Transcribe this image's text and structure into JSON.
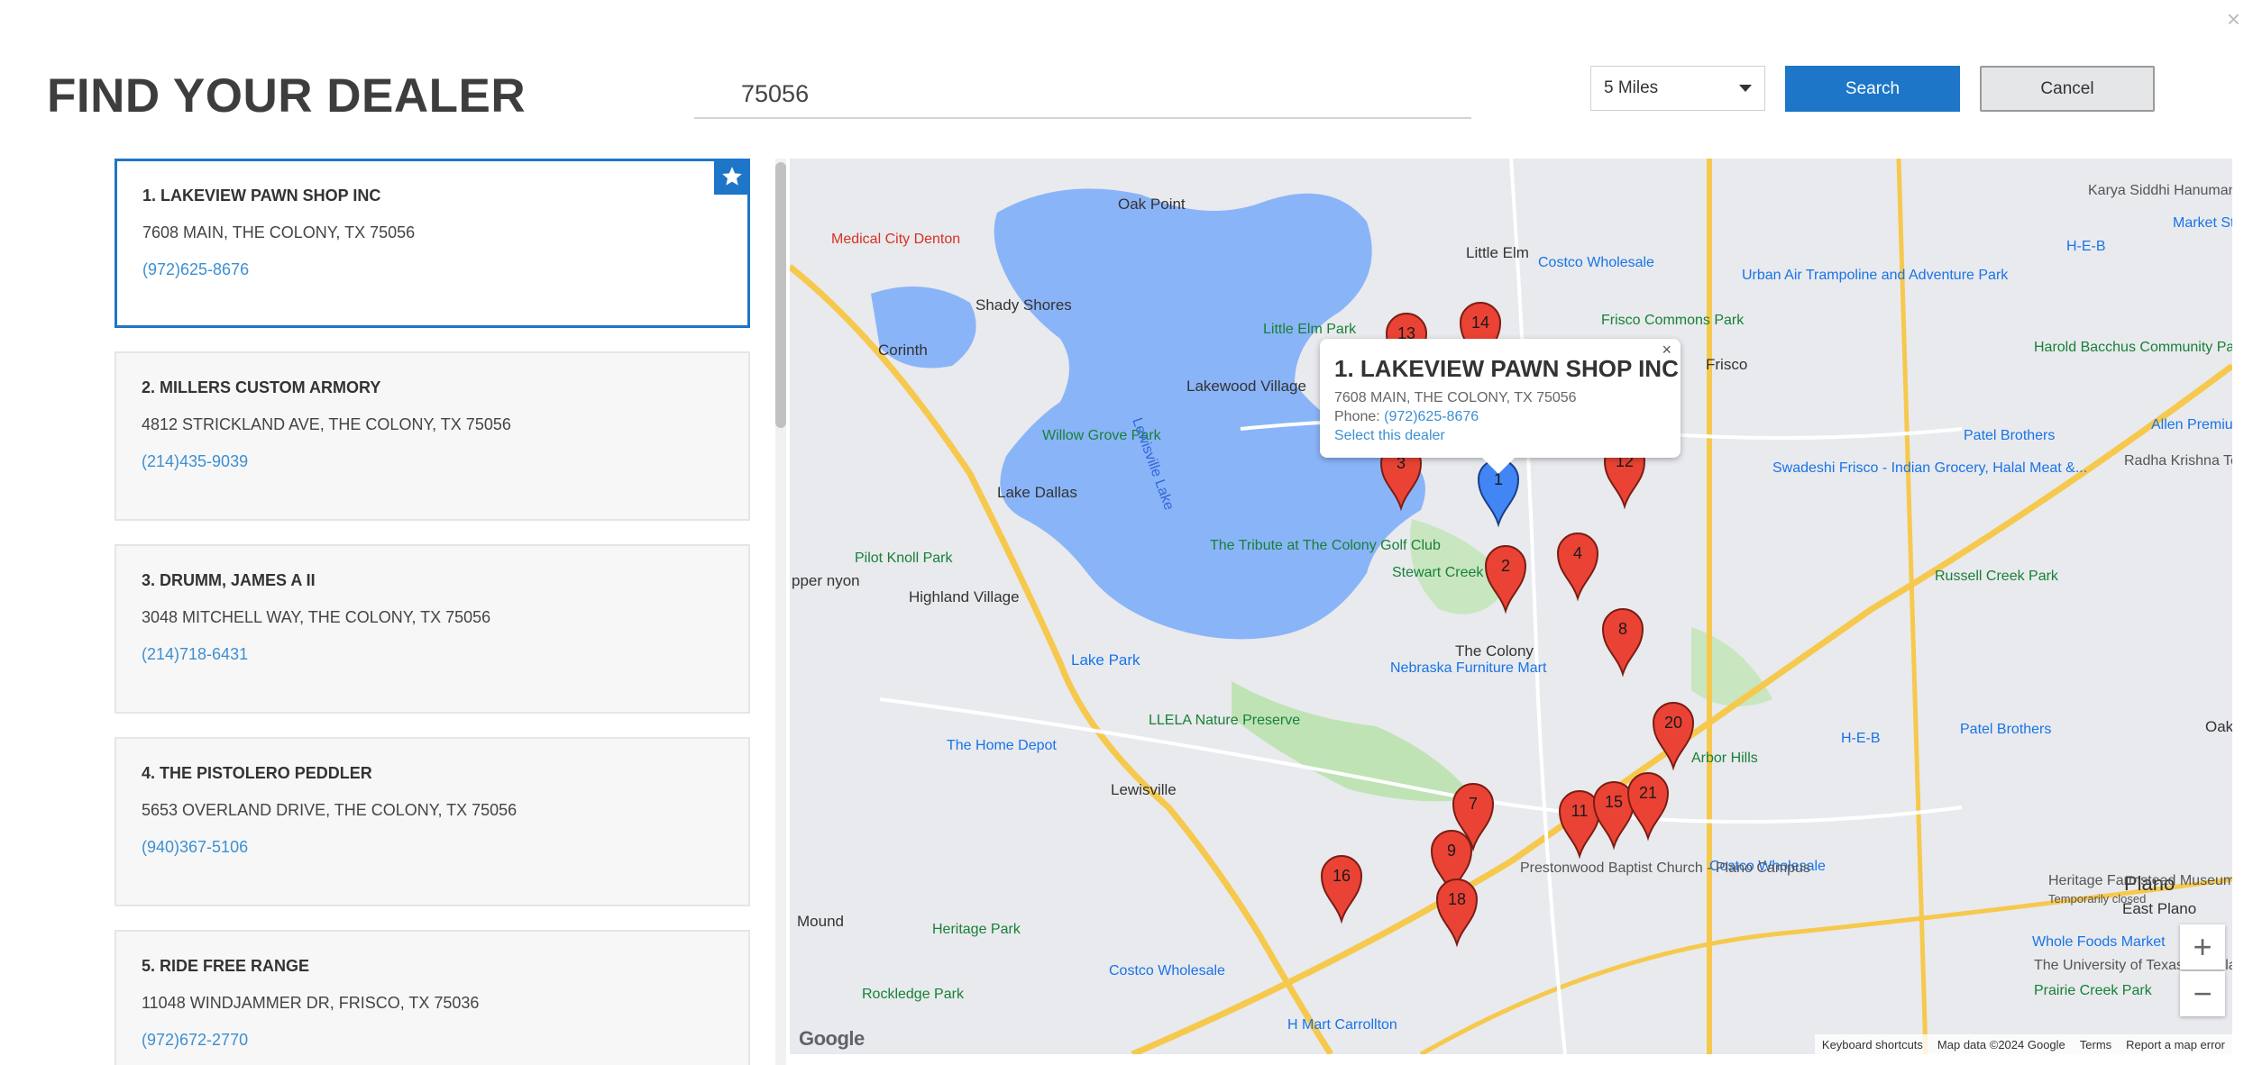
{
  "dialog": {
    "close_symbol": "×"
  },
  "header": {
    "title": "FIND YOUR DEALER",
    "search_value": "75056",
    "radius_selected": "5 Miles",
    "search_label": "Search",
    "cancel_label": "Cancel"
  },
  "dealers": [
    {
      "name": "1. LAKEVIEW PAWN SHOP INC",
      "address": "7608 MAIN, THE COLONY, TX 75056",
      "phone": "(972)625-8676",
      "selected": true
    },
    {
      "name": "2. MILLERS CUSTOM ARMORY",
      "address": "4812 STRICKLAND AVE, THE COLONY, TX 75056",
      "phone": "(214)435-9039"
    },
    {
      "name": "3. DRUMM, JAMES A II",
      "address": "3048 MITCHELL WAY, THE COLONY, TX 75056",
      "phone": "(214)718-6431"
    },
    {
      "name": "4. THE PISTOLERO PEDDLER",
      "address": "5653 OVERLAND DRIVE, THE COLONY, TX 75056",
      "phone": "(940)367-5106"
    },
    {
      "name": "5. RIDE FREE RANGE",
      "address": "11048 WINDJAMMER DR, FRISCO, TX 75036",
      "phone": "(972)672-2770"
    }
  ],
  "map": {
    "popup": {
      "title": "1. LAKEVIEW PAWN SHOP INC",
      "address": "7608 MAIN, THE COLONY, TX 75056",
      "phone_label": "Phone:",
      "phone": "(972)625-8676",
      "select_link": "Select this dealer",
      "close_symbol": "×"
    },
    "zoom_in": "+",
    "zoom_out": "−",
    "footer": {
      "shortcuts": "Keyboard shortcuts",
      "map_data": "Map data ©2024 Google",
      "terms": "Terms",
      "report": "Report a map error"
    },
    "logo": "Google",
    "place_labels": {
      "oak_point": "Oak Point",
      "little_elm": "Little Elm",
      "frisco": "Frisco",
      "lake_dallas": "Lake Dallas",
      "lakewood_village": "Lakewood Village",
      "shady_shores": "Shady Shores",
      "corinth": "Corinth",
      "highland_village": "Highland Village",
      "lewisville": "Lewisville",
      "the_colony": "The Colony",
      "plano": "Plano",
      "east_plano": "East Plano",
      "lake_park": "Lake Park",
      "lewisville_lake": "Lewisville Lake",
      "medical_city": "Medical City Denton",
      "costco1": "Costco Wholesale",
      "costco2": "Costco Wholesale",
      "costco3": "Costco Wholesale",
      "home_depot": "The Home Depot",
      "heritage_park": "Heritage Park",
      "rockledge": "Rockledge Park",
      "h_mart": "H Mart Carrollton",
      "nebraska": "Nebraska Furniture Mart",
      "patel_brothers": "Patel Brothers",
      "patel_brothers2": "Patel Brothers",
      "market_street": "Market Street",
      "heb1": "H-E-B",
      "heb2": "H-E-B",
      "whole_foods": "Whole Foods Market",
      "urban_air": "Urban Air Trampoline and Adventure Park",
      "pilot_knoll": "Pilot Knoll Park",
      "stewart_creek": "Stewart Creek Park",
      "willow_grove": "Willow Grove Park",
      "tribute": "The Tribute at The Colony Golf Club",
      "llela": "LLELA Nature Preserve",
      "little_elm_park": "Little Elm Park",
      "frisco_commons": "Frisco Commons Park",
      "harold_bacchus": "Harold Bacchus Community Park",
      "karya_siddhi": "Karya Siddhi Hanuman Temple",
      "radha_krishna": "Radha Krishna Temple of Dallas",
      "allen_premium": "Allen Premium O",
      "swadeshi": "Swadeshi Frisco - Indian Grocery, Halal Meat &...",
      "russell_creek": "Russell Creek Park",
      "prestonwood": "Prestonwood Baptist Church - Plano Campus",
      "heritage_farmstead": "Heritage Farmstead Museum",
      "temporarily_closed": "Temporarily closed",
      "prairie_creek": "Prairie Creek Park",
      "ut_dallas": "The University of Texas at Dallas",
      "arbor_hills": "Arbor Hills",
      "mound": "Mound",
      "upper_canyon": "pper nyon",
      "oak": "Oak"
    },
    "markers": [
      "1",
      "2",
      "3",
      "4",
      "7",
      "8",
      "9",
      "11",
      "12",
      "13",
      "14",
      "15",
      "16",
      "18",
      "20",
      "21"
    ]
  }
}
